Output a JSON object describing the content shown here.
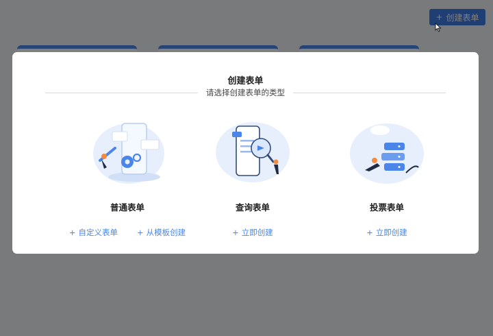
{
  "header": {
    "create_button_plus": "+",
    "create_button_label": "创建表单"
  },
  "modal": {
    "title": "创建表单",
    "subtitle": "请选择创建表单的类型",
    "options": [
      {
        "title": "普通表单",
        "illustration": "gears-phone-illustration",
        "links": [
          {
            "plus": "+",
            "label": "自定义表单"
          },
          {
            "plus": "+",
            "label": "从模板创建"
          }
        ]
      },
      {
        "title": "查询表单",
        "illustration": "phone-search-illustration",
        "links": [
          {
            "plus": "+",
            "label": "立即创建"
          }
        ]
      },
      {
        "title": "投票表单",
        "illustration": "server-stack-illustration",
        "links": [
          {
            "plus": "+",
            "label": "立即创建"
          }
        ]
      }
    ]
  },
  "colors": {
    "accent": "#4a86ea",
    "overlay": "rgba(0,0,0,0.5)",
    "modal_bg": "#ffffff"
  }
}
